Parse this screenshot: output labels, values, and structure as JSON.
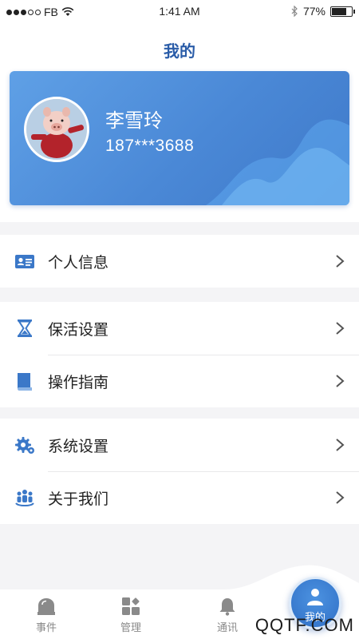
{
  "status_bar": {
    "carrier": "FB",
    "time": "1:41 AM",
    "battery": "77%",
    "battery_level": 0.77
  },
  "header": {
    "title": "我的"
  },
  "profile": {
    "name": "李雪玲",
    "phone": "187***3688"
  },
  "menu": {
    "personal_info": "个人信息",
    "keepalive_settings": "保活设置",
    "guide": "操作指南",
    "system_settings": "系统设置",
    "about_us": "关于我们"
  },
  "tabs": {
    "events": "事件",
    "manage": "管理",
    "contacts": "通讯",
    "mine": "我的"
  },
  "watermark": "QQTF.COM",
  "colors": {
    "accent": "#2a5ca8",
    "card": "#4a88d6",
    "icon": "#3b78c8"
  }
}
